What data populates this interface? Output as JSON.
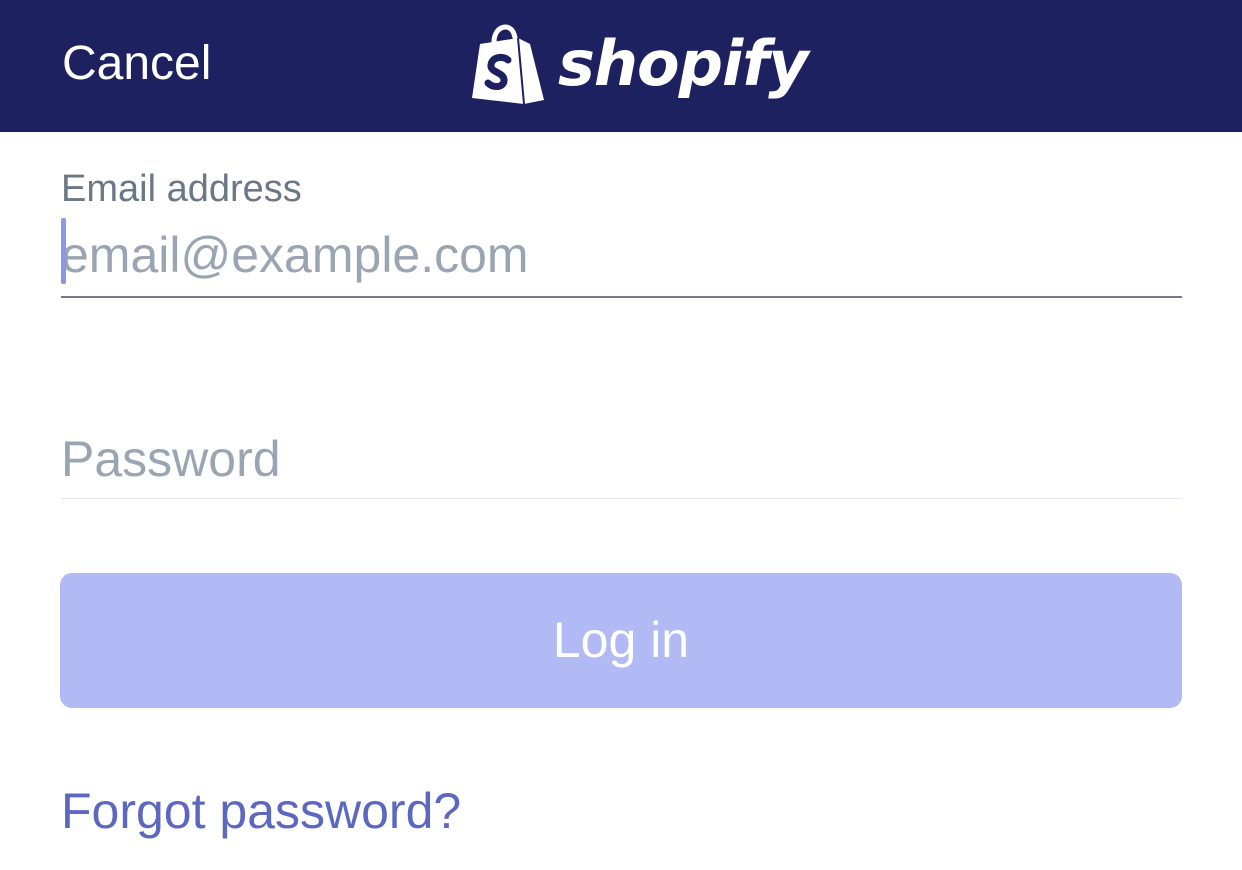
{
  "header": {
    "cancel_label": "Cancel",
    "brand_wordmark": "shopify",
    "logo_icon": "shopping-bag-icon",
    "background_color": "#1e2160"
  },
  "login_form": {
    "email_label": "Email address",
    "email_value": "",
    "email_placeholder": "email@example.com",
    "password_value": "",
    "password_placeholder": "Password",
    "submit_label": "Log in",
    "submit_color": "#b1baf4",
    "forgot_password_label": "Forgot password?",
    "link_color": "#5c68c0"
  }
}
